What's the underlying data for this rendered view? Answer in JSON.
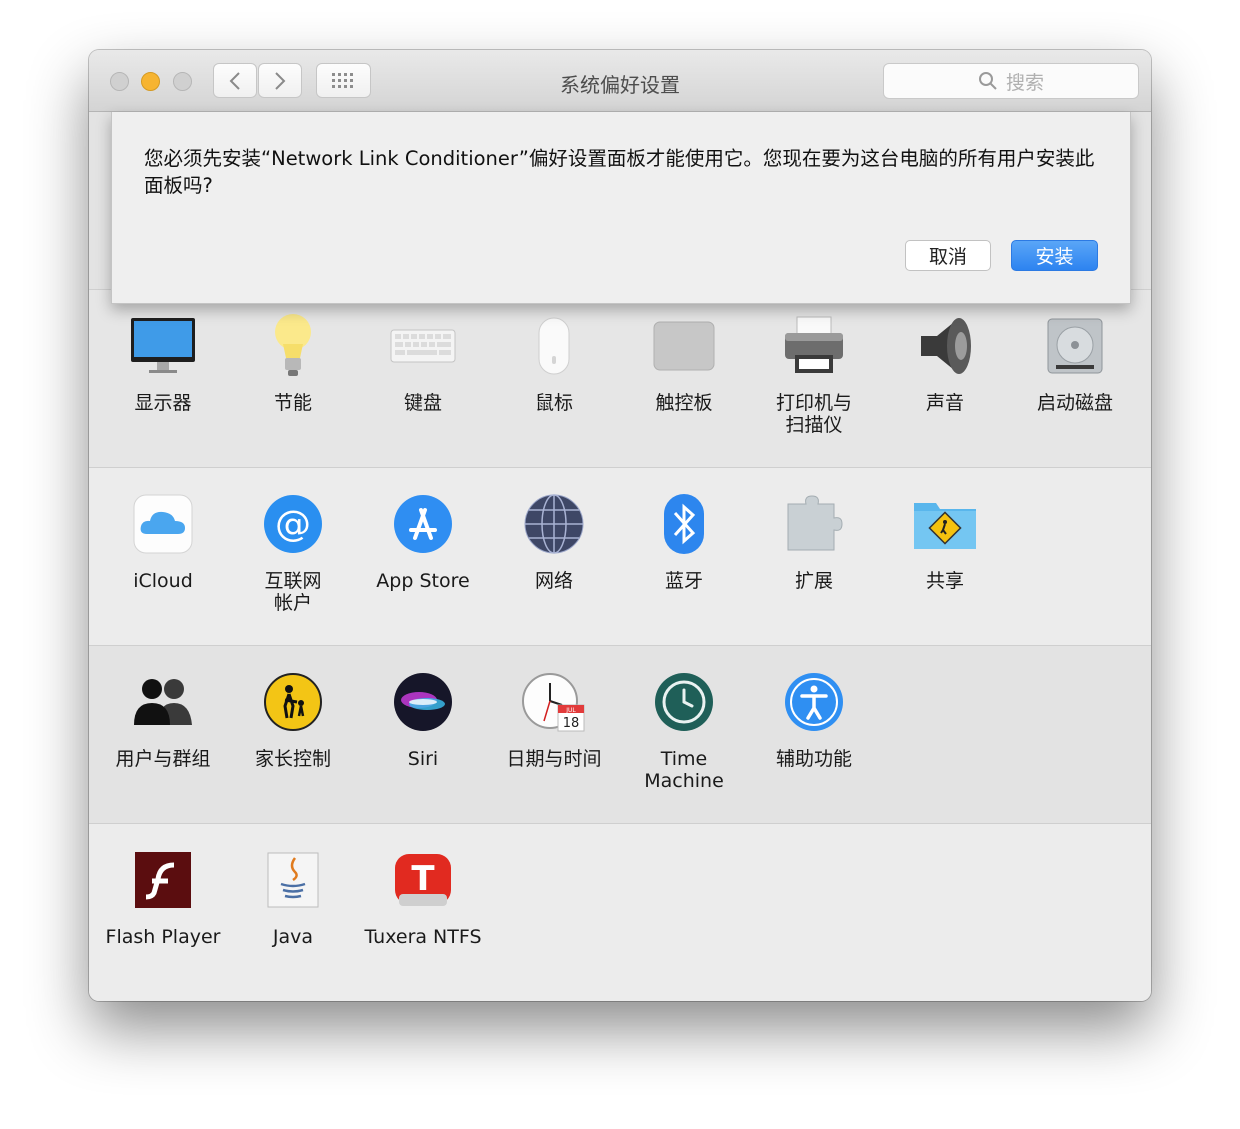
{
  "window": {
    "title": "系统偏好设置",
    "search_placeholder": "搜索"
  },
  "dialog": {
    "message": "您必须先安装“Network Link Conditioner”偏好设置面板才能使用它。您现在要为这台电脑的所有用户安装此面板吗?",
    "cancel_label": "取消",
    "install_label": "安装"
  },
  "panes": {
    "row1": [
      {
        "label": "显示器",
        "icon": "display-icon"
      },
      {
        "label": "节能",
        "icon": "lightbulb-icon"
      },
      {
        "label": "键盘",
        "icon": "keyboard-icon"
      },
      {
        "label": "鼠标",
        "icon": "mouse-icon"
      },
      {
        "label": "触控板",
        "icon": "trackpad-icon"
      },
      {
        "label": "打印机与\n扫描仪",
        "icon": "printer-icon"
      },
      {
        "label": "声音",
        "icon": "speaker-icon"
      },
      {
        "label": "启动磁盘",
        "icon": "hard-disk-icon"
      }
    ],
    "row2": [
      {
        "label": "iCloud",
        "icon": "icloud-icon"
      },
      {
        "label": "互联网\n帐户",
        "icon": "at-sign-icon"
      },
      {
        "label": "App Store",
        "icon": "app-store-icon"
      },
      {
        "label": "网络",
        "icon": "globe-icon"
      },
      {
        "label": "蓝牙",
        "icon": "bluetooth-icon"
      },
      {
        "label": "扩展",
        "icon": "puzzle-icon"
      },
      {
        "label": "共享",
        "icon": "shared-folder-icon"
      }
    ],
    "row3": [
      {
        "label": "用户与群组",
        "icon": "users-icon"
      },
      {
        "label": "家长控制",
        "icon": "parental-controls-icon"
      },
      {
        "label": "Siri",
        "icon": "siri-icon"
      },
      {
        "label": "日期与时间",
        "icon": "clock-calendar-icon",
        "calendar_month": "JUL",
        "calendar_day": "18"
      },
      {
        "label": "Time Machine",
        "icon": "time-machine-icon"
      },
      {
        "label": "辅助功能",
        "icon": "accessibility-icon"
      }
    ],
    "row4": [
      {
        "label": "Flash Player",
        "icon": "flash-icon"
      },
      {
        "label": "Java",
        "icon": "java-icon"
      },
      {
        "label": "Tuxera NTFS",
        "icon": "tuxera-icon",
        "icon_letter": "T"
      }
    ]
  },
  "colors": {
    "accent": "#2d83f0",
    "minimize_light": "#f6b431"
  }
}
